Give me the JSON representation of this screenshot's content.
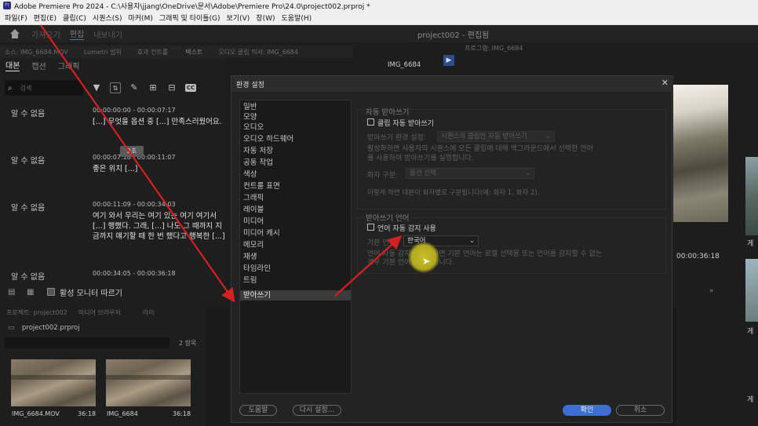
{
  "window": {
    "logo": "Pr",
    "title": "Adobe Premiere Pro 2024 - C:\\사용자\\jjang\\OneDrive\\문서\\Adobe\\Premiere Pro\\24.0\\project002.prproj *"
  },
  "menu": [
    "파일(F)",
    "편집(E)",
    "클립(C)",
    "시퀀스(S)",
    "마커(M)",
    "그래픽 및 타이틀(G)",
    "보기(V)",
    "창(W)",
    "도움말(H)"
  ],
  "workspaces": {
    "items": [
      "가져오기",
      "편집",
      "내보내기"
    ],
    "active": "편집",
    "project_title": "project002 - 편집됨"
  },
  "left_panel": {
    "tabs": [
      "소스: IMG_6684.MOV",
      "Lumetri 범위",
      "효과 컨트롤",
      "텍스트",
      "오디오 클립 믹서: IMG_6684"
    ],
    "clip_name": "IMG_6684",
    "text_tabs": [
      "대본",
      "캡션",
      "그래픽"
    ],
    "active_text_tab": "대본",
    "search_placeholder": "검색",
    "entries": [
      {
        "speaker": "알 수 없음",
        "timecode": "00:00:00:00 - 00:00:07:17",
        "text": "[...] 무엇을 옵션 중 [...] 만족스러웠어요."
      },
      {
        "speaker": "알 수 없음",
        "timecode": "00:00:07:18 - 00:00:11:07",
        "text": "좋은 위치 [...]"
      },
      {
        "speaker": "알 수 없음",
        "timecode": "00:00:11:09 - 00:00:34:03",
        "text": "여기 와서 우리는 여기 있는 여기 여기서 [...] 행했다. 그래, [...] 나도 그 때까지 지금까지 얘기할 때 한 번 했다고 행복한 [...]"
      },
      {
        "speaker": "알 수 없음",
        "timecode": "00:00:34:05 - 00:00:36:18",
        "text": ""
      }
    ],
    "follow_monitor_label": "활성 모니터 따르기",
    "tooltip": "2초"
  },
  "project_panel": {
    "tabs": [
      "프로젝트: project002",
      "미디어 브라우저",
      "라이"
    ],
    "project_file": "project002.prproj",
    "item_count": "2 항목",
    "items": [
      {
        "name": "IMG_6684.MOV",
        "duration": "36:18"
      },
      {
        "name": "IMG_6684",
        "duration": "36:18"
      }
    ]
  },
  "program_monitor": {
    "tab": "프로그램: IMG_6684",
    "timecode": "00:00:36:18",
    "side_labels": [
      "게",
      "게",
      "게"
    ]
  },
  "dialog": {
    "title": "환경 설정",
    "categories": [
      "일반",
      "모양",
      "오디오",
      "오디오 하드웨어",
      "자동 저장",
      "공동 작업",
      "색상",
      "컨트롤 표면",
      "그래픽",
      "레이블",
      "미디어",
      "미디어 캐시",
      "메모리",
      "재생",
      "타임라인",
      "트림",
      "받아쓰기"
    ],
    "selected_category": "받아쓰기",
    "auto_transcribe": {
      "heading": "자동 받아쓰기",
      "checkbox_label": "클립 자동 받아쓰기",
      "settings_label": "받아쓰기 환경 설정:",
      "settings_value": "시퀀스의 클립만 자동 받아쓰기",
      "description": "활성화하면 사용자의 시퀀스에 모든 클립에 대해 백그라운드에서 선택한 언어를 사용하여 받아쓰기를 실행합니다.",
      "speaker_label": "화자 구분:",
      "speaker_value": "옵션 선택",
      "speaker_hint": "이렇게 하면 대본이 화자별로 구분됩니다(예: 화자 1, 화자 2)."
    },
    "language": {
      "heading": "받아쓰기 언어",
      "auto_detect_label": "언어 자동 감지 사용",
      "default_label": "기본 언어:",
      "default_value": "한국어",
      "description": "언어 자동 감지를 사용하면 기본 언어는 로캘 선택용 또는 언어를 감지할 수 없는 경우 기본 언어로 사용됩니다."
    },
    "buttons": {
      "help": "도움말",
      "reset": "다시 설정...",
      "ok": "확인",
      "cancel": "취소"
    }
  },
  "annotation": {
    "arrow_color": "#d42020"
  }
}
